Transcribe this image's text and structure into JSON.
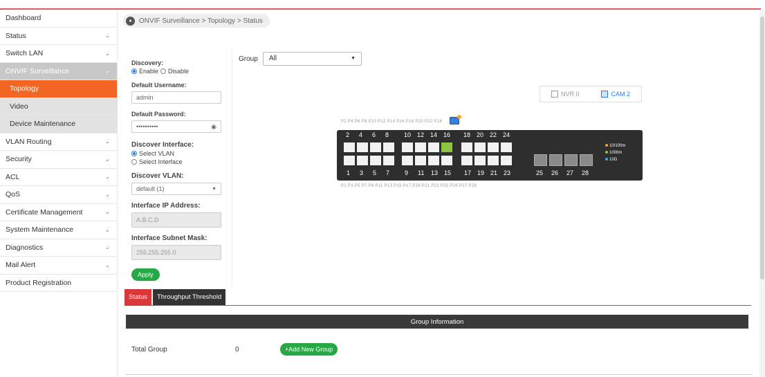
{
  "breadcrumb": "ONVIF Surveillance > Topology > Status",
  "sidebar": {
    "items": [
      {
        "label": "Dashboard",
        "chevron": false
      },
      {
        "label": "Status",
        "chevron": true
      },
      {
        "label": "Switch LAN",
        "chevron": true
      },
      {
        "label": "ONVIF Surveillance",
        "chevron": true
      },
      {
        "label": "Topology",
        "chevron": false
      },
      {
        "label": "Video",
        "chevron": false
      },
      {
        "label": "Device Maintenance",
        "chevron": false
      },
      {
        "label": "VLAN Routing",
        "chevron": true
      },
      {
        "label": "Security",
        "chevron": true
      },
      {
        "label": "ACL",
        "chevron": true
      },
      {
        "label": "QoS",
        "chevron": true
      },
      {
        "label": "Certificate Management",
        "chevron": true
      },
      {
        "label": "System Maintenance",
        "chevron": true
      },
      {
        "label": "Diagnostics",
        "chevron": true
      },
      {
        "label": "Mail Alert",
        "chevron": true
      },
      {
        "label": "Product Registration",
        "chevron": false
      }
    ]
  },
  "form": {
    "discovery_label": "Discovery:",
    "enable": "Enable",
    "disable": "Disable",
    "username_label": "Default Username:",
    "username_value": "admin",
    "password_label": "Default Password:",
    "password_value": "••••••••••",
    "interface_label": "Discover Interface:",
    "select_vlan": "Select VLAN",
    "select_interface": "Select Interface",
    "vlan_label": "Discover VLAN:",
    "vlan_value": "default (1)",
    "ip_label": "Interface IP Address:",
    "ip_value": "A.B.C.D",
    "mask_label": "Interface Subnet Mask:",
    "mask_value": "255.255.255.0",
    "apply": "Apply"
  },
  "group": {
    "label": "Group",
    "value": "All"
  },
  "devices": {
    "nvr": "NVR 0",
    "cam": "CAM 2"
  },
  "switch": {
    "top_port_labels": "P2  P4  P6  P8     P10  P12  P14  P16     P18  P20  P22  P24",
    "bottom_port_labels": "P1  P3  P5  P7     P9  P11  P13  P15     P17  P19  P21  P23    P25  P26  P27  P28",
    "top_numbers": [
      "2",
      "4",
      "6",
      "8",
      "10",
      "12",
      "14",
      "16",
      "18",
      "20",
      "22",
      "24"
    ],
    "bottom_numbers": [
      "1",
      "3",
      "5",
      "7",
      "9",
      "11",
      "13",
      "15",
      "17",
      "19",
      "21",
      "23",
      "25",
      "26",
      "27",
      "28"
    ],
    "legend": [
      "10/100m",
      "1000m",
      "10G"
    ],
    "legend_colors": [
      "#f5a623",
      "#8cc63f",
      "#3aa9e8"
    ]
  },
  "tabs": {
    "status": "Status",
    "threshold": "Throughput Threshold"
  },
  "group_info": {
    "header": "Group Information",
    "total_label": "Total Group",
    "total_value": "0",
    "add_button": "+Add New Group"
  }
}
